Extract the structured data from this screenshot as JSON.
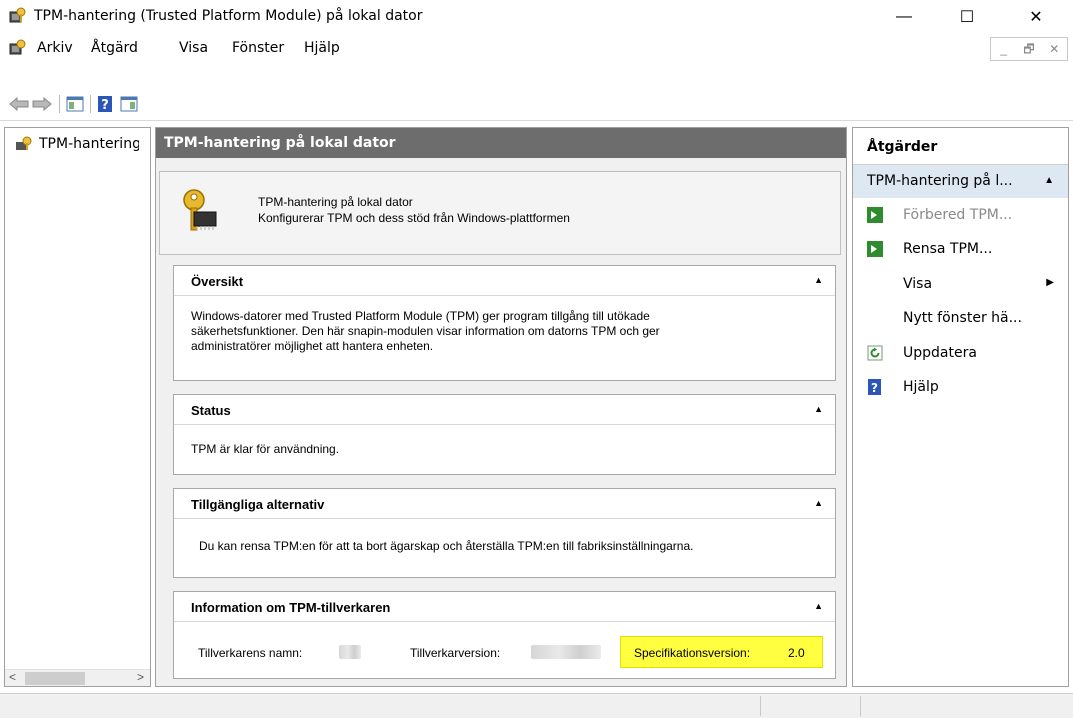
{
  "window": {
    "title": "TPM-hantering (Trusted Platform Module) på lokal dator",
    "minimize": "—",
    "maximize": "☐",
    "close": "✕"
  },
  "menu": {
    "items": [
      "Arkiv",
      "Åtgärd",
      "Visa",
      "Fönster",
      "Hjälp"
    ],
    "mdi": [
      "_",
      "🗗",
      "✕"
    ]
  },
  "toolbar": {
    "icons": [
      "back-arrow-icon",
      "forward-arrow-icon",
      "show-hide-console-tree-icon",
      "help-icon",
      "show-hide-action-pane-icon"
    ]
  },
  "tree": {
    "root_label": "TPM-hantering på lokal dator",
    "scroll_left": "<",
    "scroll_right": ">"
  },
  "main": {
    "header": "TPM-hantering på lokal dator",
    "intro_title": "TPM-hantering på lokal dator",
    "intro_desc": "Konfigurerar TPM och dess stöd från Windows-plattformen",
    "sections": {
      "overview": {
        "title": "Översikt",
        "line1": "Windows-datorer med Trusted Platform Module (TPM) ger program tillgång till utökade",
        "line2": "säkerhetsfunktioner. Den här snapin-modulen visar information om datorns TPM och ger",
        "line3": "administratörer möjlighet att hantera enheten."
      },
      "status": {
        "title": "Status",
        "text": "TPM är klar för användning."
      },
      "options": {
        "title": "Tillgängliga alternativ",
        "text": "Du kan rensa TPM:en för att ta bort ägarskap och återställa TPM:en till fabriksinställningarna."
      },
      "manufacturer": {
        "title": "Information om TPM-tillverkaren",
        "name_label": "Tillverkarens namn:",
        "version_label": "Tillverkarversion:",
        "spec_label": "Specifikationsversion:",
        "spec_value": "2.0"
      }
    },
    "collapse_glyph": "▲"
  },
  "actions": {
    "header": "Åtgärder",
    "group_title": "TPM-hantering på l...",
    "group_caret": "▲",
    "items": [
      {
        "label": "Förbered TPM...",
        "icon": "green-arrow-icon",
        "enabled": false
      },
      {
        "label": "Rensa TPM...",
        "icon": "green-arrow-icon",
        "enabled": true
      },
      {
        "label": "Visa",
        "icon": "",
        "submenu": "▶"
      },
      {
        "label": "Nytt fönster hä...",
        "icon": ""
      },
      {
        "label": "Uppdatera",
        "icon": "refresh-icon"
      },
      {
        "label": "Hjälp",
        "icon": "help-icon"
      }
    ]
  },
  "colors": {
    "header_bg": "#6d6d6d",
    "action_group_bg": "#dde8f3",
    "highlight": "#ffff40",
    "enabled_green": "#2e8b2e"
  }
}
